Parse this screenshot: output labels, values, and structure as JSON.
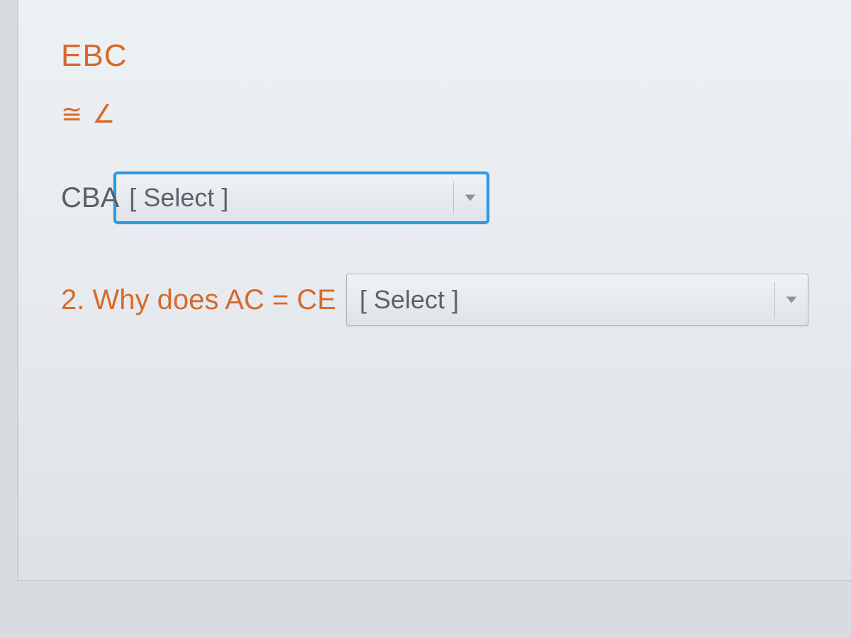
{
  "line1": "EBC",
  "symbols": {
    "congruent": "≅",
    "angle": "∠"
  },
  "cba_label": "CBA",
  "select1": {
    "placeholder": "[ Select ]"
  },
  "question2": {
    "text": "2. Why does AC = CE"
  },
  "select2": {
    "placeholder": "[ Select ]"
  }
}
